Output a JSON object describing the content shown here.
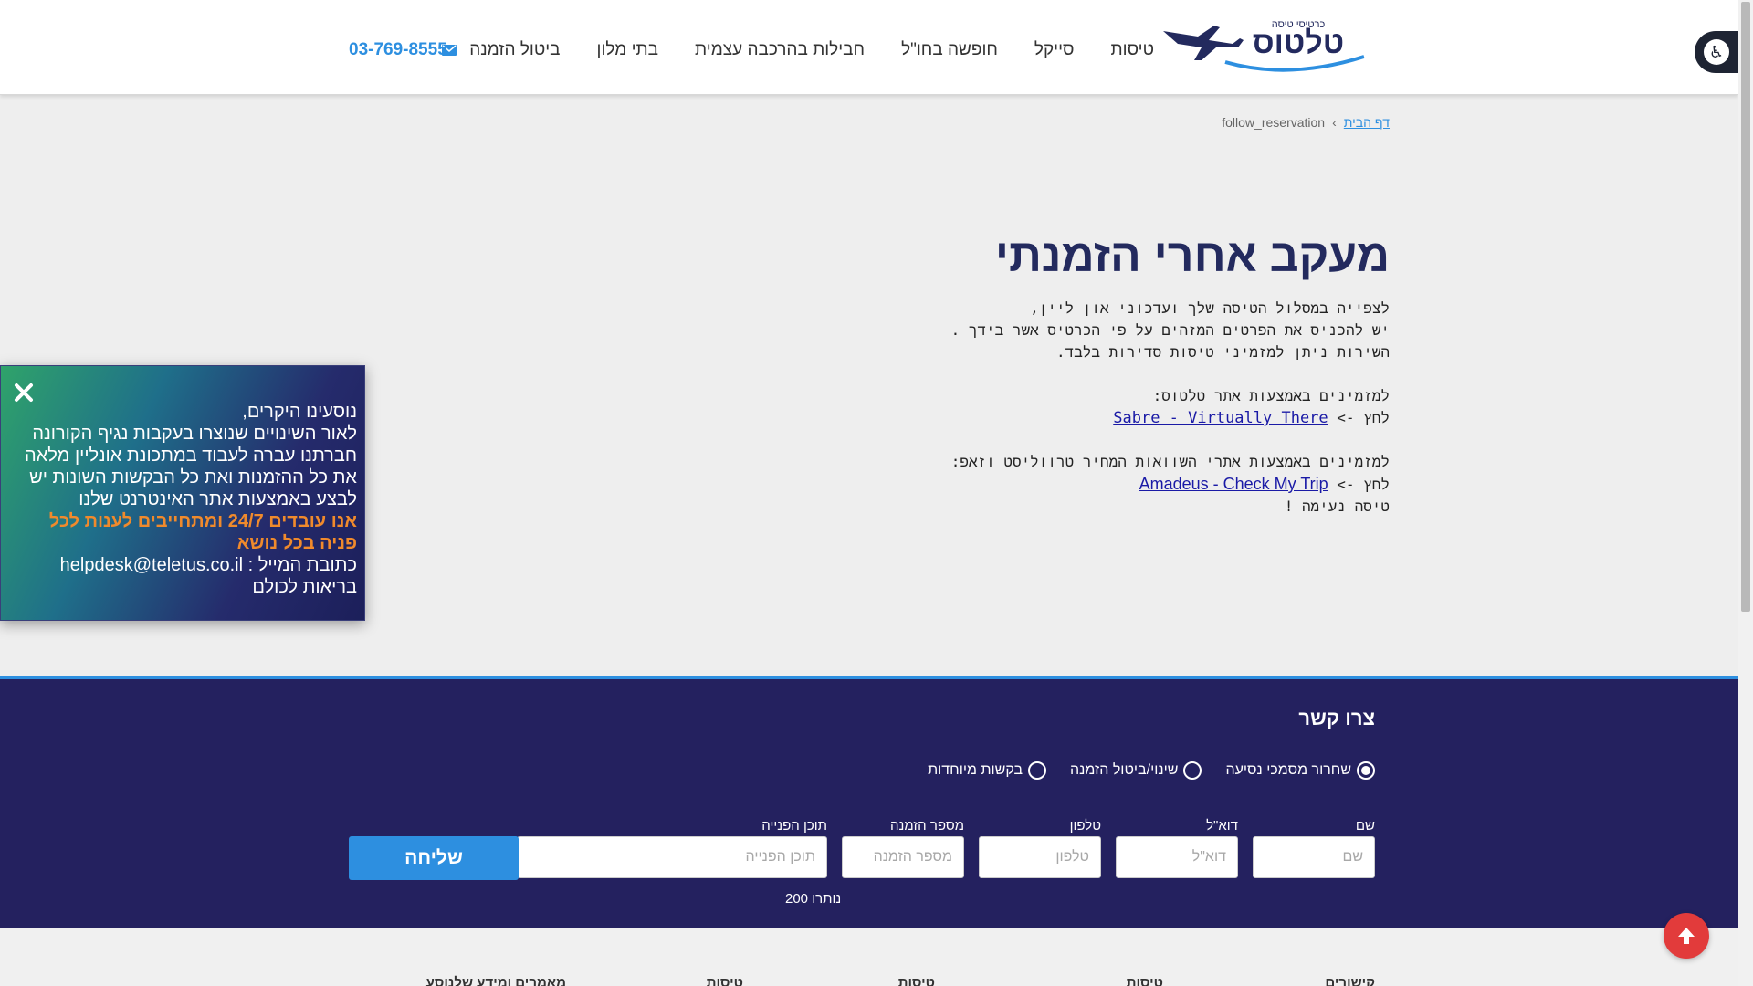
{
  "header": {
    "nav": [
      {
        "label": "טיסות"
      },
      {
        "label": "סייקל"
      },
      {
        "label": "חופשה בחו\"ל"
      },
      {
        "label": "חבילות בהרכבה עצמית"
      },
      {
        "label": "בתי מלון"
      },
      {
        "label": "ביטול הזמנה"
      }
    ],
    "phone": "03-769-8555",
    "logo_text": "טלטוס",
    "logo_tagline": "כרטיסי טיסה"
  },
  "breadcrumb": {
    "home": "דף הבית",
    "current": "follow_reservation"
  },
  "main": {
    "title": "מעקב אחרי הזמנתי",
    "intro_lines": [
      "לצפייה במסלול הטיסה שלך ועדכוני און ליין,",
      "יש להכניס את הפרטים המזהים על פי הכרטיס אשר בידך .",
      "השירות ניתן למזמיני טיסות סדירות בלבד."
    ],
    "section1_label": "למזמינים באמצעות אתר טלטוס:",
    "click_prefix": "לחץ ->",
    "link1": "Sabre - Virtually There",
    "section2_label": "למזמינים באמצעות אתרי השוואות המחיר טרווליסט וזאפ:",
    "link2": "Amadeus - Check My Trip",
    "closing": "טיסה נעימה !"
  },
  "popup": {
    "line1": "נוסעינו היקרים,",
    "line2": "לאור השינויים שנוצרו בעקבות נגיף הקורונה",
    "line3": "חברתנו עברה לעבוד במתכונת אונליין מלאה",
    "line4": "את כל ההזמנות ואת כל הבקשות השונות יש",
    "line5": "לבצע באמצעות אתר האינטרנט שלנו",
    "highlight1": "אנו עובדים 24/7 ומתחייבים לענות לכל",
    "highlight2": "פניה בכל נושא",
    "email_line": "כתובת המייל : helpdesk@teletus.co.il",
    "closing": "בריאות לכולם"
  },
  "contact": {
    "title": "צרו קשר",
    "radios": [
      {
        "label": "שחרור מסמכי נסיעה",
        "checked": true
      },
      {
        "label": "שינוי/ביטול הזמנה",
        "checked": false
      },
      {
        "label": "בקשות מיוחדות",
        "checked": false
      }
    ],
    "fields": {
      "name_label": "שם",
      "name_placeholder": "שם",
      "email_label": "דוא\"ל",
      "email_placeholder": "דוא\"ל",
      "phone_label": "טלפון",
      "phone_placeholder": "טלפון",
      "order_label": "מספר הזמנה",
      "order_placeholder": "מספר הזמנה",
      "content_label": "תוכן הפנייה",
      "content_placeholder": "תוכן הפנייה"
    },
    "remaining": "נותרו 200",
    "submit": "שליחה"
  },
  "footer": {
    "cols": [
      "קישורים",
      "טיסות",
      "טיסות",
      "טיסות",
      "מאמרים ומידע שלנוסע"
    ]
  },
  "colors": {
    "brand_navy": "#232a5e",
    "accent_blue": "#2d8fe0",
    "contact_bg": "#24215f",
    "popup_highlight": "#f08a2c",
    "back_to_top": "#e23b3b"
  }
}
